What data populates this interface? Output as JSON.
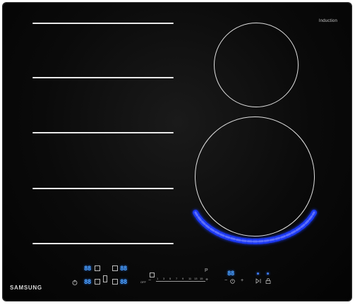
{
  "labels": {
    "induction": "Induction",
    "brand": "SAMSUNG"
  },
  "controls": {
    "zone_displays": [
      "88",
      "88",
      "88",
      "88"
    ],
    "timer_display": "88",
    "off_label": "OFF",
    "minus_symbol": "−",
    "plus_symbol": "+",
    "boost_label": "P",
    "slider_ticks": [
      "1",
      "3",
      "5",
      "7",
      "9",
      "11",
      "13",
      "15"
    ]
  },
  "colors": {
    "surface": "#0a0a0a",
    "lines": "#e8e8e8",
    "display": "#4da3ff",
    "flame_led": "#2f4dff"
  }
}
